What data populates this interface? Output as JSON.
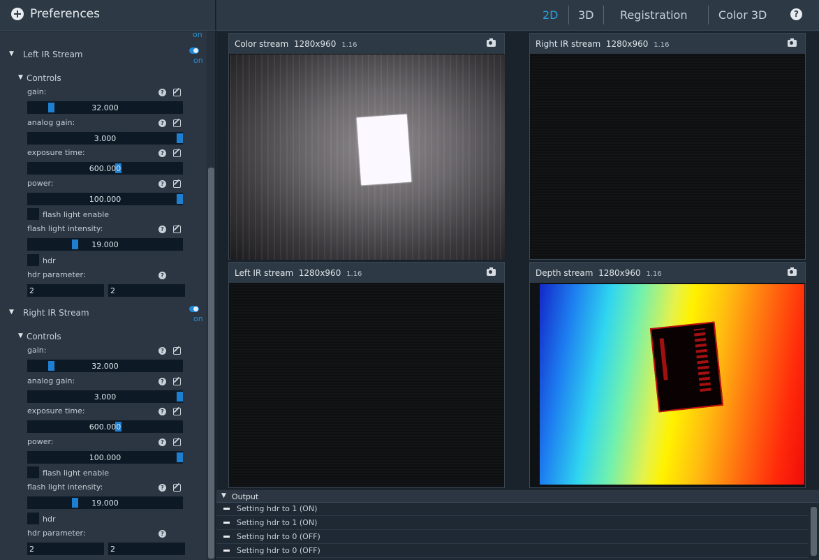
{
  "header": {
    "title": "Preferences",
    "tabs": [
      {
        "label": "2D",
        "active": true
      },
      {
        "label": "3D",
        "active": false
      },
      {
        "label": "Registration",
        "active": false
      },
      {
        "label": "Color 3D",
        "active": false
      }
    ],
    "help_icon": "help-icon"
  },
  "sidebar": {
    "top_on_text": "on",
    "sections": [
      {
        "title": "Left IR Stream",
        "toggle_on": true,
        "on_text": "on",
        "controls_title": "Controls",
        "gain_label": "gain:",
        "gain_value": "32.000",
        "gain_fraction": 0.14,
        "analog_gain_label": "analog gain:",
        "analog_gain_value": "3.000",
        "analog_gain_fraction": 1.0,
        "exposure_label": "exposure time:",
        "exposure_value": "600.000",
        "exposure_fraction": 0.59,
        "power_label": "power:",
        "power_value": "100.000",
        "power_fraction": 1.0,
        "flash_enable_label": "flash light enable",
        "flash_intensity_label": "flash light intensity:",
        "flash_intensity_value": "19.000",
        "flash_intensity_fraction": 0.3,
        "hdr_label": "hdr",
        "hdr_param_label": "hdr parameter:",
        "hdr_param_a": "2",
        "hdr_param_b": "2"
      },
      {
        "title": "Right IR Stream",
        "toggle_on": true,
        "on_text": "on",
        "controls_title": "Controls",
        "gain_label": "gain:",
        "gain_value": "32.000",
        "gain_fraction": 0.14,
        "analog_gain_label": "analog gain:",
        "analog_gain_value": "3.000",
        "analog_gain_fraction": 1.0,
        "exposure_label": "exposure time:",
        "exposure_value": "600.000",
        "exposure_fraction": 0.59,
        "power_label": "power:",
        "power_value": "100.000",
        "power_fraction": 1.0,
        "flash_enable_label": "flash light enable",
        "flash_intensity_label": "flash light intensity:",
        "flash_intensity_value": "19.000",
        "flash_intensity_fraction": 0.3,
        "hdr_label": "hdr",
        "hdr_param_label": "hdr parameter:",
        "hdr_param_a": "2",
        "hdr_param_b": "2"
      }
    ]
  },
  "streams": {
    "color": {
      "title": "Color stream",
      "resolution": "1280x960",
      "fps": "1.16"
    },
    "right_ir": {
      "title": "Right IR stream",
      "resolution": "1280x960",
      "fps": "1.16"
    },
    "left_ir": {
      "title": "Left IR stream",
      "resolution": "1280x960",
      "fps": "1.16"
    },
    "depth": {
      "title": "Depth stream",
      "resolution": "1280x960",
      "fps": "1.16"
    }
  },
  "output": {
    "title": "Output",
    "logs": [
      "Setting hdr to 1 (ON)",
      "Setting hdr to 1 (ON)",
      "Setting hdr to 0 (OFF)",
      "Setting hdr to 0 (OFF)"
    ]
  },
  "colors": {
    "accent": "#2e9bd6",
    "slider_thumb": "#1e7fd0",
    "panel": "#2b3642"
  }
}
